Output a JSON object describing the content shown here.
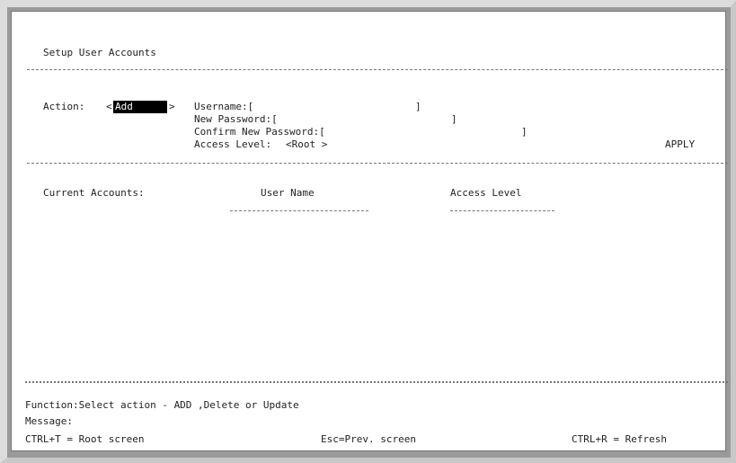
{
  "screen": {
    "title": "Setup User Accounts",
    "action_label": "Action:",
    "action_lt": "<",
    "action_value": "Add",
    "action_gt": ">",
    "username_label": "Username:[",
    "username_close": "]",
    "new_password_label": "New Password:[",
    "new_password_close": "]",
    "confirm_password_label": "Confirm New Password:[",
    "confirm_password_close": "]",
    "access_level_label": "Access Level:",
    "access_level_value": "<Root >",
    "apply_label": "APPLY",
    "current_accounts_label": "Current Accounts:",
    "col_user_name": "User Name",
    "col_access_level": "Access Level",
    "function_line": "Function:Select action - ADD ,Delete or Update",
    "message_label": "Message:",
    "root_screen_hint": "CTRL+T = Root screen",
    "prev_screen_hint": "Esc=Prev. screen",
    "refresh_hint": "CTRL+R = Refresh"
  }
}
